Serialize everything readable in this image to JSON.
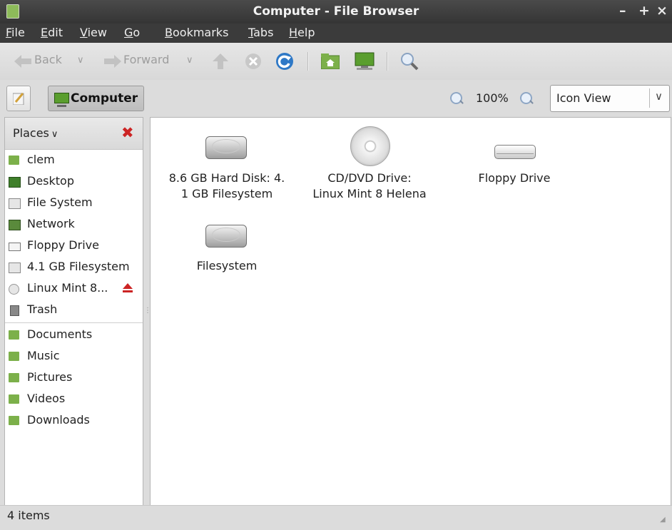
{
  "window": {
    "title": "Computer - File Browser",
    "controls": {
      "minimize": "–",
      "maximize": "+",
      "close": "×"
    }
  },
  "menubar": {
    "items": [
      {
        "label": "File",
        "mnemonic": "F"
      },
      {
        "label": "Edit",
        "mnemonic": "E"
      },
      {
        "label": "View",
        "mnemonic": "V"
      },
      {
        "label": "Go",
        "mnemonic": "G"
      },
      {
        "label": "Bookmarks",
        "mnemonic": "B"
      },
      {
        "label": "Tabs",
        "mnemonic": "T"
      },
      {
        "label": "Help",
        "mnemonic": "H"
      }
    ]
  },
  "toolbar": {
    "back_label": "Back",
    "forward_label": "Forward",
    "chevron": "∨"
  },
  "location": {
    "crumb_label": "Computer",
    "zoom_level": "100%",
    "view_mode": "Icon View"
  },
  "sidebar": {
    "header_label": "Places",
    "places": [
      {
        "label": "clem",
        "icon": "home-folder-icon"
      },
      {
        "label": "Desktop",
        "icon": "desktop-icon"
      },
      {
        "label": "File System",
        "icon": "filesystem-icon"
      },
      {
        "label": "Network",
        "icon": "network-icon"
      },
      {
        "label": "Floppy Drive",
        "icon": "floppy-icon"
      },
      {
        "label": "4.1 GB Filesystem",
        "icon": "drive-icon"
      },
      {
        "label": "Linux Mint 8...",
        "icon": "cd-icon"
      },
      {
        "label": "Trash",
        "icon": "trash-icon"
      }
    ],
    "bookmarks": [
      {
        "label": "Documents",
        "icon": "documents-folder-icon"
      },
      {
        "label": "Music",
        "icon": "music-folder-icon"
      },
      {
        "label": "Pictures",
        "icon": "pictures-folder-icon"
      },
      {
        "label": "Videos",
        "icon": "videos-folder-icon"
      },
      {
        "label": "Downloads",
        "icon": "downloads-folder-icon"
      }
    ]
  },
  "content": {
    "items": [
      {
        "line1": "8.6 GB Hard Disk: 4.",
        "line2": "1 GB Filesystem",
        "icon": "harddisk-icon"
      },
      {
        "line1": "CD/DVD Drive:",
        "line2": "Linux Mint 8 Helena",
        "icon": "cd-dvd-icon"
      },
      {
        "line1": "Floppy Drive",
        "line2": "",
        "icon": "floppy-drive-icon"
      },
      {
        "line1": "Filesystem",
        "line2": "",
        "icon": "filesystem-drive-icon"
      }
    ]
  },
  "statusbar": {
    "text": "4 items"
  },
  "colors": {
    "accent_green": "#7cb04a",
    "eject_red": "#cc2424",
    "titlebar": "#3b3b3b"
  }
}
